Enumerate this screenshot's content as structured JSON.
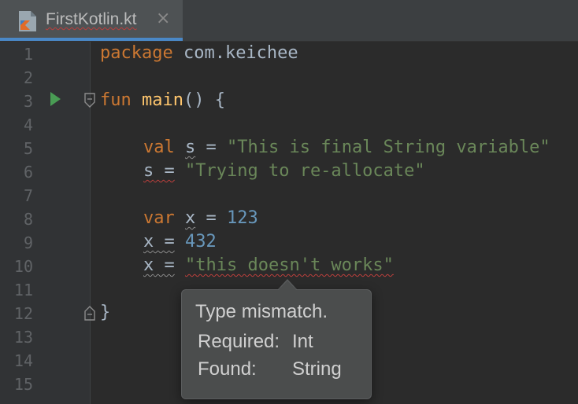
{
  "tab": {
    "title": "FirstKotlin.kt",
    "close_glyph": "×",
    "icon": "kotlin-file-icon"
  },
  "editor": {
    "line_numbers": [
      "1",
      "2",
      "3",
      "4",
      "5",
      "6",
      "7",
      "8",
      "9",
      "10",
      "11",
      "12",
      "13",
      "14",
      "15"
    ],
    "line1": {
      "kw": "package",
      "rest": " com.keichee"
    },
    "line3": {
      "kw": "fun",
      "name": "main",
      "rest": "() {"
    },
    "line5": {
      "kw": "val",
      "sp": " ",
      "var": "s",
      "eq": " = ",
      "str": "\"This is final String variable\""
    },
    "line6": {
      "var": "s",
      "eq": " =",
      "sp": " ",
      "str": "\"Trying to re-allocate\""
    },
    "line8": {
      "kw": "var",
      "sp": " ",
      "var": "x",
      "eq": " = ",
      "num": "123"
    },
    "line9": {
      "var": "x",
      "eq": " =",
      "sp": " ",
      "num": "432"
    },
    "line10": {
      "var": "x",
      "eq": " =",
      "sp": " ",
      "str": "\"this doesn't works\""
    },
    "line12": {
      "brace": "}"
    }
  },
  "tooltip": {
    "title": "Type mismatch.",
    "required_label": "Required:",
    "required_value": "Int",
    "found_label": "Found:",
    "found_value": "String"
  },
  "colors": {
    "background": "#2b2b2b",
    "keyword": "#cc7832",
    "function": "#ffc66d",
    "string": "#6a8759",
    "number": "#6897bb",
    "error_underline": "#bc3f3c",
    "tab_accent": "#4a88c7"
  }
}
